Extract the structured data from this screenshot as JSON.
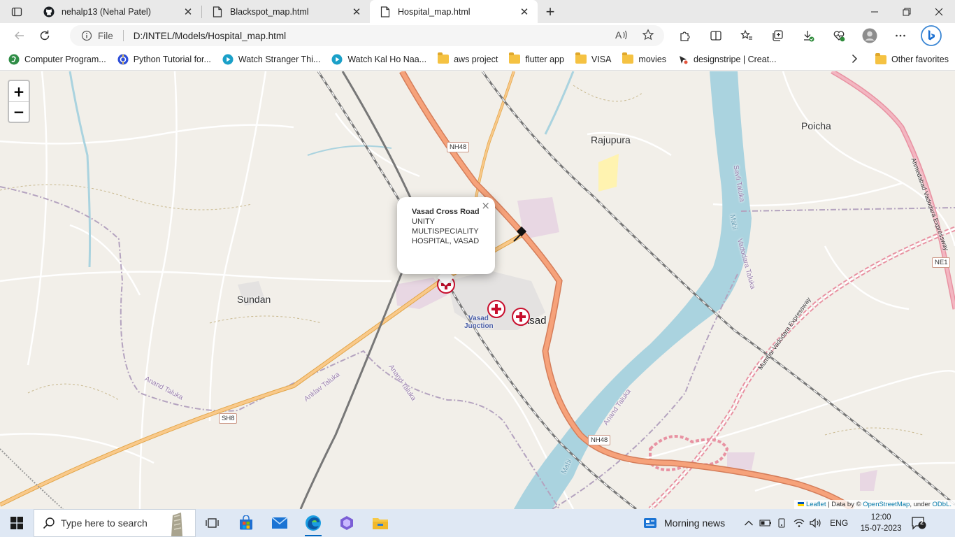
{
  "browser": {
    "tabs": [
      {
        "title": "nehalp13 (Nehal Patel)",
        "icon": "github-icon",
        "active": false
      },
      {
        "title": "Blackspot_map.html",
        "icon": "file-icon",
        "active": false
      },
      {
        "title": "Hospital_map.html",
        "icon": "file-icon",
        "active": true
      }
    ],
    "tab_close_glyph": "✕",
    "new_tab_glyph": "+",
    "address": {
      "scheme_label": "File",
      "url": "D:/INTEL/Models/Hospital_map.html"
    },
    "favorites": [
      {
        "label": "Computer Program...",
        "icon": "green-site-icon"
      },
      {
        "label": "Python Tutorial for...",
        "icon": "blue-site-icon"
      },
      {
        "label": "Watch Stranger Thi...",
        "icon": "play-icon"
      },
      {
        "label": "Watch Kal Ho Naa...",
        "icon": "play-icon"
      },
      {
        "label": "aws project",
        "icon": "folder-icon"
      },
      {
        "label": "flutter app",
        "icon": "folder-icon"
      },
      {
        "label": "VISA",
        "icon": "folder-icon"
      },
      {
        "label": "movies",
        "icon": "folder-icon"
      },
      {
        "label": "designstripe | Creat...",
        "icon": "designstripe-icon"
      }
    ],
    "other_favorites": "Other favorites"
  },
  "map": {
    "zoom_in": "+",
    "zoom_out": "−",
    "labels": {
      "rajupura": "Rajupura",
      "poicha": "Poicha",
      "sundan": "Sundan",
      "vasad": "Vasad",
      "vasad_junction_1": "Vasad",
      "vasad_junction_2": "Junction",
      "anand_taluka_1": "Anand Taluka",
      "anand_taluka_2": "Anand Taluka",
      "anand_taluka_3": "Anand Taluka",
      "anklav_taluka": "Anklav Taluka",
      "vadodara_taluka": "Vadodara Taluka",
      "savli_taluka": "Savli Taluka",
      "mahi_1": "Mahi",
      "mahi_2": "Mahi",
      "expressway_1": "Mumbai Vadodara Expressway",
      "expressway_2": "Ahmedabad Vadodara Expressway"
    },
    "shields": {
      "nh48_top": "NH48",
      "nh48_bottom": "NH48",
      "sh8": "SH8",
      "ne1": "NE1"
    },
    "popup": {
      "title": "Vasad Cross Road",
      "body": "UNITY MULTISPECIALITY HOSPITAL, VASAD",
      "close": "×"
    },
    "attribution": {
      "leaflet": "Leaflet",
      "data_by": " | Data by © ",
      "osm": "OpenStreetMap",
      "under": ", under ",
      "odbl": "ODbL."
    },
    "marker_count": 3,
    "colors": {
      "land": "#f2efe9",
      "river": "#aad3df",
      "trunk_road": "#f6a27a",
      "primary_road": "#f9c98a",
      "railway": "#777777",
      "marker_red": "#c8102e"
    }
  },
  "taskbar": {
    "search_placeholder": "Type here to search",
    "news": "Morning news",
    "language": "ENG",
    "time": "12:00",
    "date": "15-07-2023",
    "notification_count": "2"
  }
}
